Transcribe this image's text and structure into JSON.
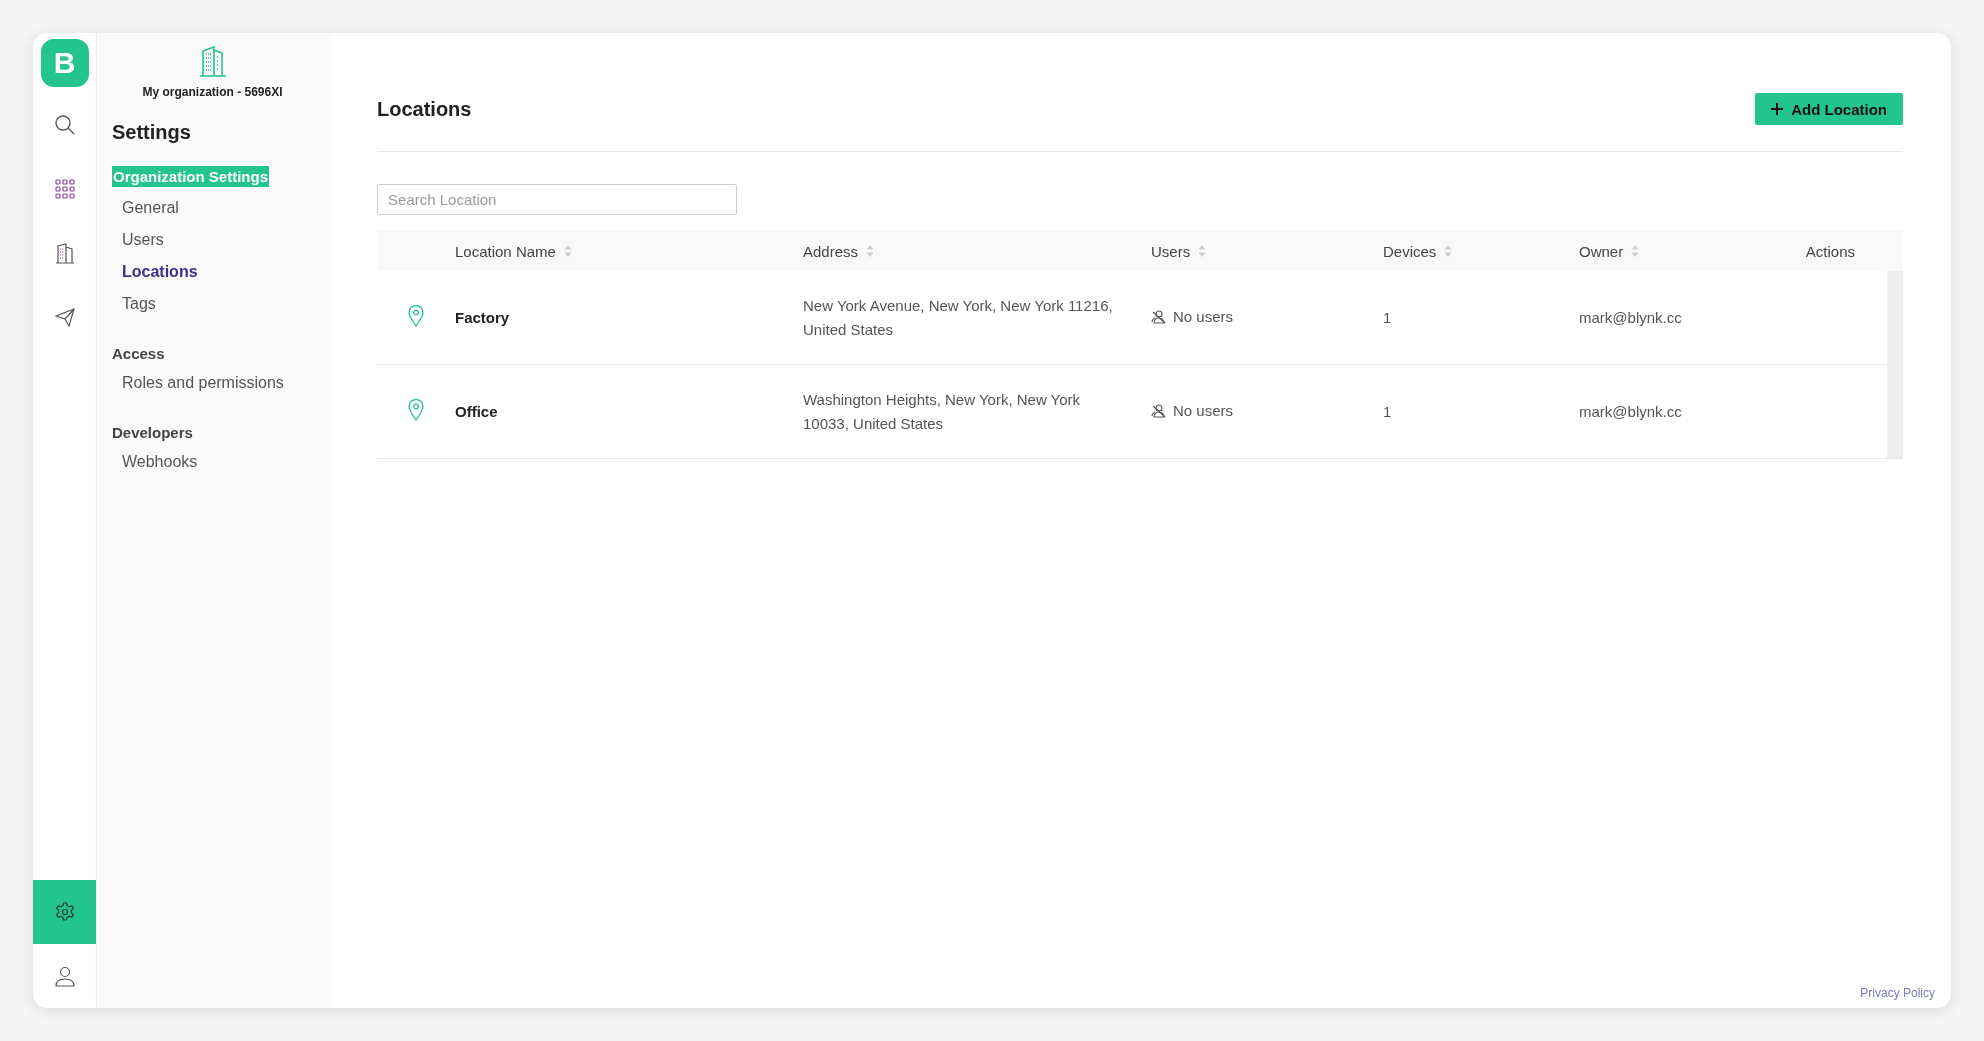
{
  "rail": {
    "logo": "B",
    "items": [
      {
        "kind": "search",
        "selected": false
      },
      {
        "kind": "grid",
        "selected": false
      },
      {
        "kind": "building",
        "selected": false
      },
      {
        "kind": "send",
        "selected": false
      }
    ],
    "bottom_items": [
      {
        "kind": "settings",
        "selected": true
      },
      {
        "kind": "user",
        "selected": false
      }
    ]
  },
  "sidebar": {
    "organization": "My organization - 5696XI",
    "title": "Settings",
    "sections": [
      {
        "title": "Organization Settings",
        "highlighted": true,
        "items": [
          {
            "label": "General",
            "selected": false
          },
          {
            "label": "Users",
            "selected": false
          },
          {
            "label": "Locations",
            "selected": true
          },
          {
            "label": "Tags",
            "selected": false
          }
        ]
      },
      {
        "title": "Access",
        "highlighted": false,
        "items": [
          {
            "label": "Roles and permissions",
            "selected": false
          }
        ]
      },
      {
        "title": "Developers",
        "highlighted": false,
        "items": [
          {
            "label": "Webhooks",
            "selected": false
          }
        ]
      }
    ]
  },
  "main": {
    "title": "Locations",
    "add_button": "Add Location",
    "search": {
      "placeholder": "Search Location"
    },
    "table": {
      "columns": [
        {
          "label": "Location Name",
          "sortable": true
        },
        {
          "label": "Address",
          "sortable": true
        },
        {
          "label": "Users",
          "sortable": true
        },
        {
          "label": "Devices",
          "sortable": true
        },
        {
          "label": "Owner",
          "sortable": true
        },
        {
          "label": "Actions",
          "sortable": false
        }
      ],
      "rows": [
        {
          "name": "Factory",
          "address": "New York Avenue, New York, New York 11216, United States",
          "users": "No users",
          "devices": "1",
          "owner": "mark@blynk.cc"
        },
        {
          "name": "Office",
          "address": "Washington Heights, New York, New York 10033, United States",
          "users": "No users",
          "devices": "1",
          "owner": "mark@blynk.cc"
        }
      ]
    }
  },
  "footer": {
    "link": "Privacy Policy"
  }
}
